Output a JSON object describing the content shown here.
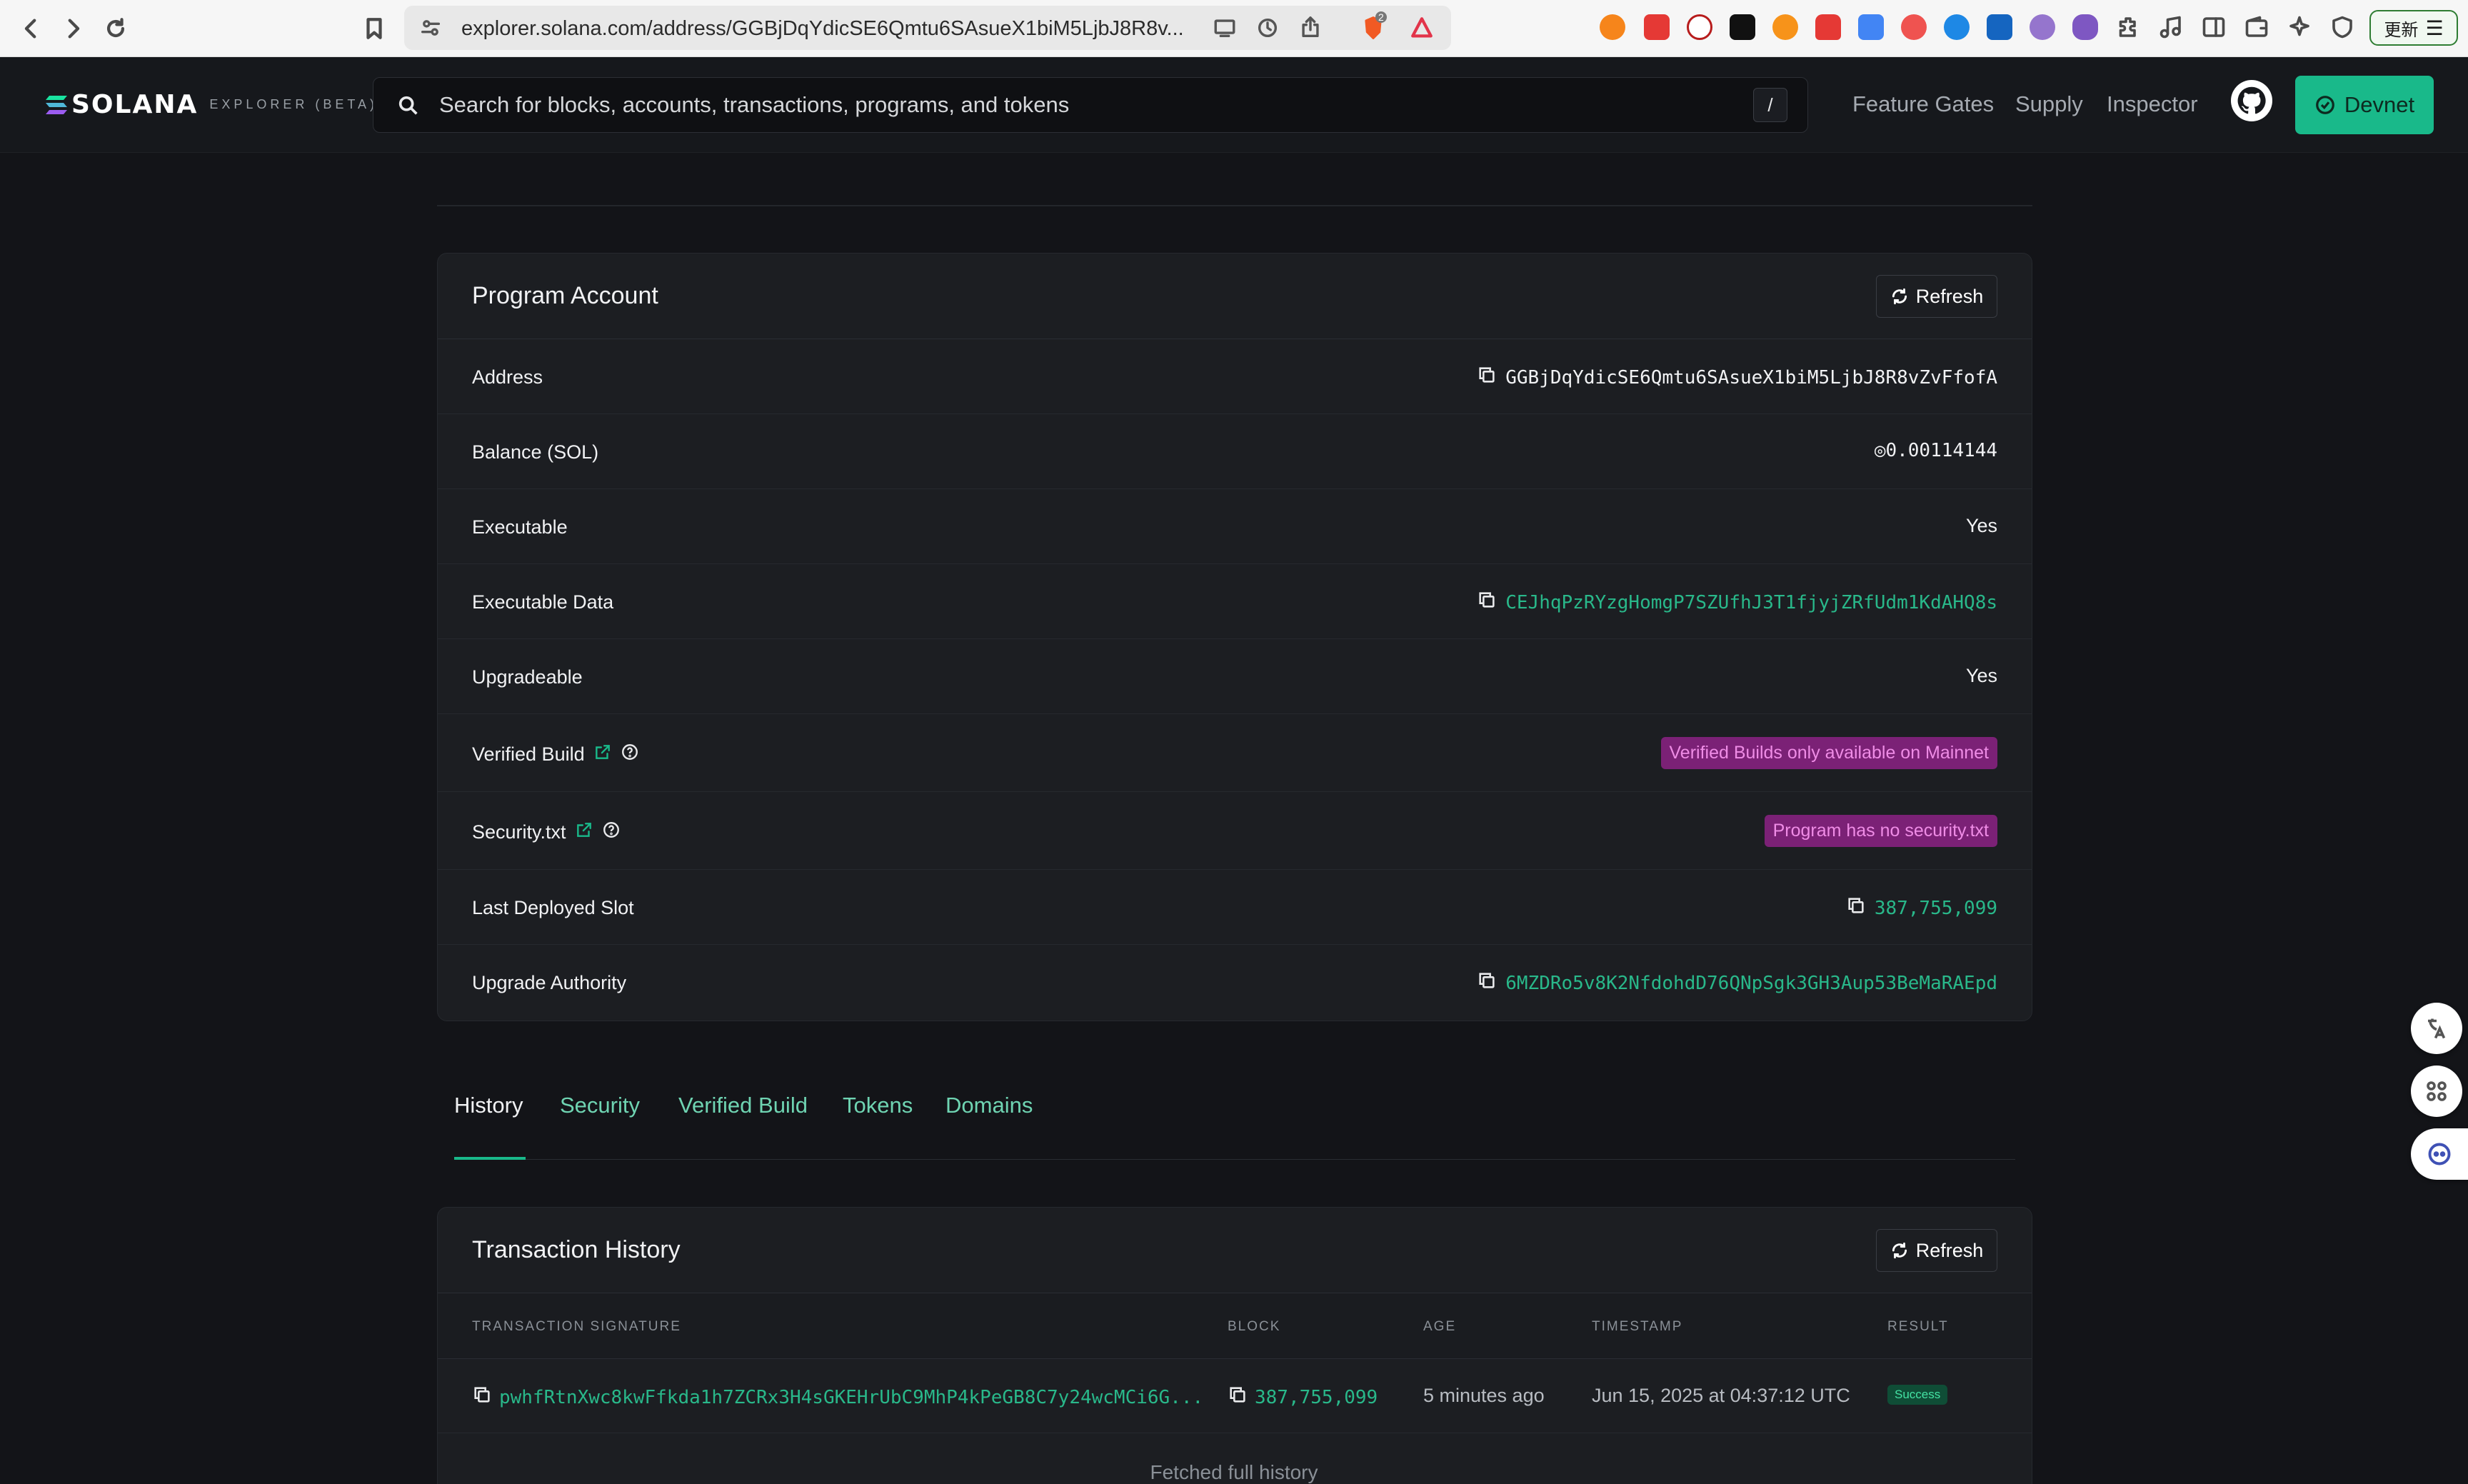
{
  "browser": {
    "url": "explorer.solana.com/address/GGBjDqYdicSE6Qmtu6SAsueX1biM5LjbJ8R8v...",
    "update_label": "更新",
    "brave_badge": "2"
  },
  "header": {
    "brand": "SOLANA",
    "brand_sub": "EXPLORER (BETA)",
    "search_placeholder": "Search for blocks, accounts, transactions, programs, and tokens",
    "search_shortcut": "/",
    "nav": [
      "Feature Gates",
      "Supply",
      "Inspector"
    ],
    "cluster_label": "Devnet"
  },
  "program_account": {
    "title": "Program Account",
    "refresh_label": "Refresh",
    "rows": [
      {
        "label": "Address",
        "value": "GGBjDqYdicSE6Qmtu6SAsueX1biM5LjbJ8R8vZvFfofA"
      },
      {
        "label": "Balance (SOL)",
        "value": "◎0.00114144"
      },
      {
        "label": "Executable",
        "value": "Yes"
      },
      {
        "label": "Executable Data",
        "value": "CEJhqPzRYzgHomgP7SZUfhJ3T1fjyjZRfUdm1KdAHQ8s"
      },
      {
        "label": "Upgradeable",
        "value": "Yes"
      },
      {
        "label": "Verified Build",
        "value": "Verified Builds only available on Mainnet"
      },
      {
        "label": "Security.txt",
        "value": "Program has no security.txt"
      },
      {
        "label": "Last Deployed Slot",
        "value": "387,755,099"
      },
      {
        "label": "Upgrade Authority",
        "value": "6MZDRo5v8K2NfdohdD76QNpSgk3GH3Aup53BeMaRAEpd"
      }
    ]
  },
  "tabs": [
    "History",
    "Security",
    "Verified Build",
    "Tokens",
    "Domains"
  ],
  "active_tab": "History",
  "transaction_history": {
    "title": "Transaction History",
    "refresh_label": "Refresh",
    "columns": [
      "TRANSACTION SIGNATURE",
      "BLOCK",
      "AGE",
      "TIMESTAMP",
      "RESULT"
    ],
    "rows": [
      {
        "signature": "pwhfRtnXwc8kwFfkda1h7ZCRx3H4sGKEHrUbC9MhP4kPeGB8C7y24wcMCi6G...",
        "block": "387,755,099",
        "age": "5 minutes ago",
        "timestamp": "Jun 15, 2025 at 04:37:12 UTC",
        "result": "Success"
      }
    ],
    "footer": "Fetched full history"
  },
  "colors": {
    "accent": "#19b98a",
    "link": "#29b88a",
    "badge_purple_bg": "#7b2176",
    "badge_success_bg": "#0f4d36"
  }
}
